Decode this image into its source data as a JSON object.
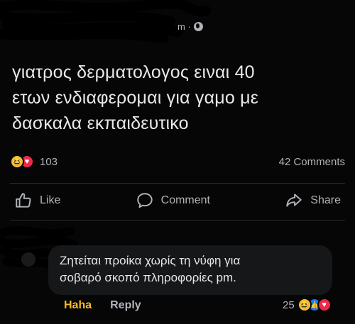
{
  "post": {
    "meta_time": "m ·",
    "text_line1": "γιατρος δερματολογος ειναι 40",
    "text_line2": "ετων ενδιαφερομαι για γαμο με",
    "text_line3": "δασκαλα εκπαιδευτικο",
    "reaction_count": "103",
    "comments_count": "42 Comments"
  },
  "actions": {
    "like": "Like",
    "comment": "Comment",
    "share": "Share"
  },
  "comment": {
    "line1": "Ζητείται προίκα χωρίς τη νύφη για",
    "line2": "σοβαρό σκοπό πληροφορίες pm.",
    "reaction_label": "Haha",
    "reply_label": "Reply",
    "reaction_count": "25"
  },
  "colors": {
    "background": "#060606",
    "text": "#e4e6eb",
    "muted": "#b0b3b8",
    "haha": "#f7b928",
    "like_blue": "#1877f2",
    "love_red": "#f0284a"
  }
}
